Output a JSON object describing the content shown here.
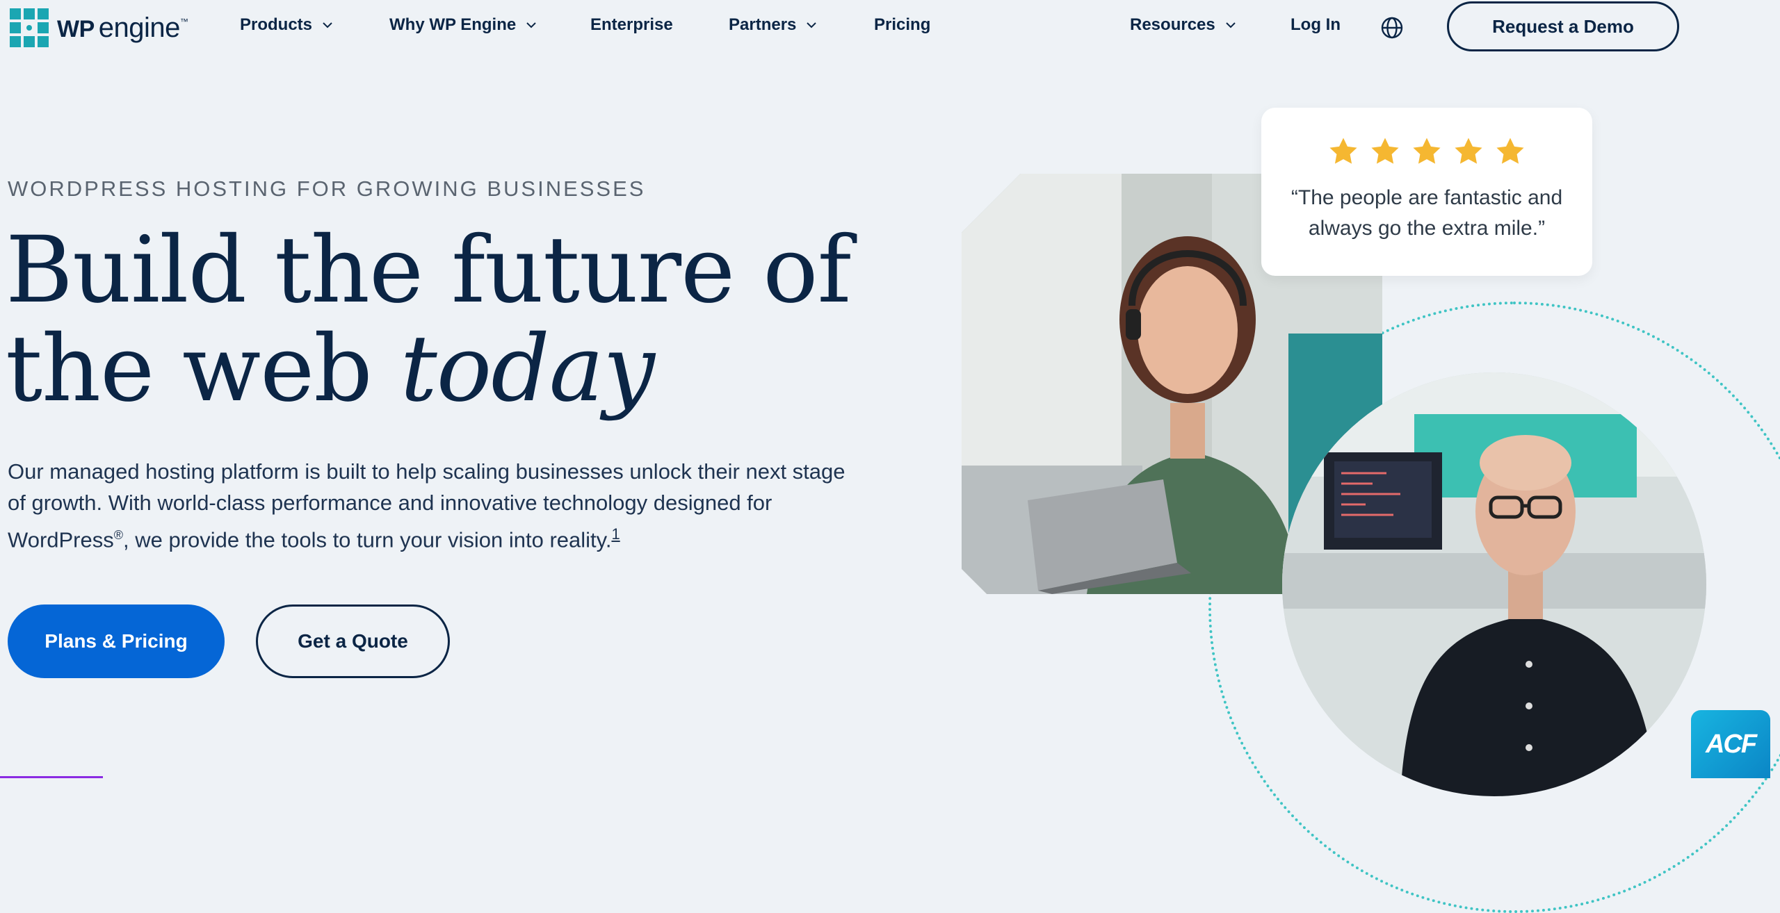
{
  "header": {
    "logo": {
      "wp": "WP",
      "engine": "engine",
      "tm": "™"
    },
    "nav": [
      {
        "label": "Products",
        "dropdown": true
      },
      {
        "label": "Why WP Engine",
        "dropdown": true
      },
      {
        "label": "Enterprise",
        "dropdown": false
      },
      {
        "label": "Partners",
        "dropdown": true
      },
      {
        "label": "Pricing",
        "dropdown": false
      }
    ],
    "resources_label": "Resources",
    "login_label": "Log In",
    "globe_icon": "globe-icon",
    "demo_label": "Request a Demo"
  },
  "hero": {
    "eyebrow": "WORDPRESS HOSTING FOR GROWING BUSINESSES",
    "headline_line1": "Build the future of",
    "headline_line2_plain": "the web ",
    "headline_line2_italic": "today",
    "body_part1": "Our managed hosting platform is built to help scaling businesses unlock their next stage of growth. With world-class performance and innovative technology designed for WordPress",
    "body_reg": "®",
    "body_part2": ", we provide the tools to turn your vision into reality.",
    "footnote": "1",
    "primary_cta": "Plans & Pricing",
    "secondary_cta": "Get a Quote"
  },
  "review": {
    "stars": 5,
    "quote": "“The people are fantastic and always go the extra mile.”"
  },
  "badge": {
    "label": "ACF"
  },
  "colors": {
    "background": "#eef2f6",
    "navy": "#0b2545",
    "primary_blue": "#0566d6",
    "teal": "#1ba6b2",
    "star_gold": "#f5b731"
  }
}
